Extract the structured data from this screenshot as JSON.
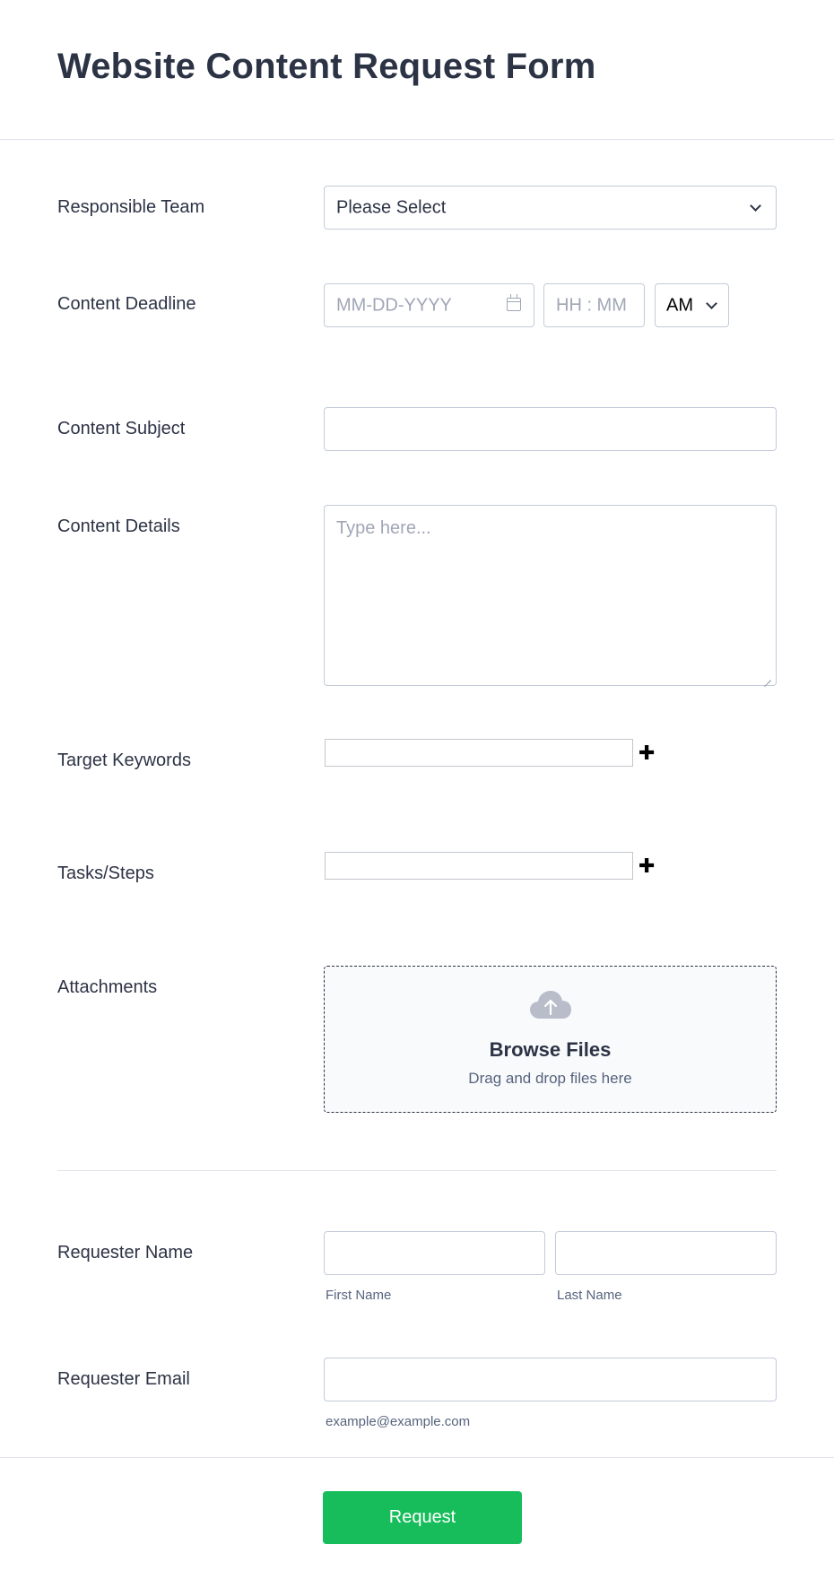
{
  "form": {
    "title": "Website Content Request Form"
  },
  "responsible_team": {
    "label": "Responsible Team",
    "selected": "Please Select"
  },
  "content_deadline": {
    "label": "Content Deadline",
    "date_placeholder": "MM-DD-YYYY",
    "time_placeholder": "HH : MM",
    "ampm_selected": "AM"
  },
  "content_subject": {
    "label": "Content Subject",
    "value": ""
  },
  "content_details": {
    "label": "Content Details",
    "placeholder": "Type here..."
  },
  "target_keywords": {
    "label": "Target Keywords",
    "add_symbol": "✚"
  },
  "tasks_steps": {
    "label": "Tasks/Steps",
    "add_symbol": "✚"
  },
  "attachments": {
    "label": "Attachments",
    "browse_label": "Browse Files",
    "hint": "Drag and drop files here"
  },
  "requester_name": {
    "label": "Requester Name",
    "first_sublabel": "First Name",
    "last_sublabel": "Last Name"
  },
  "requester_email": {
    "label": "Requester Email",
    "sublabel": "example@example.com"
  },
  "submit": {
    "label": "Request"
  },
  "colors": {
    "text": "#2c3345",
    "border": "#c3cad8",
    "submit_bg": "#18bd5b",
    "upload_bg": "#f9fafc"
  }
}
